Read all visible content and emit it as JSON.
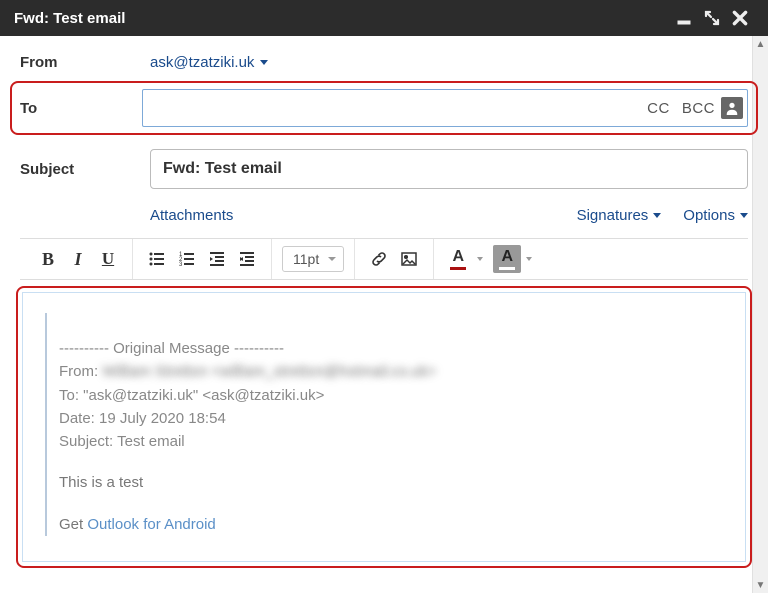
{
  "window": {
    "title": "Fwd: Test email"
  },
  "from": {
    "label": "From",
    "value": "ask@tzatziki.uk"
  },
  "to": {
    "label": "To",
    "value": "",
    "cc_label": "CC",
    "bcc_label": "BCC"
  },
  "subject": {
    "label": "Subject",
    "value": "Fwd: Test email"
  },
  "actions": {
    "attachments": "Attachments",
    "signatures": "Signatures",
    "options": "Options"
  },
  "toolbar": {
    "fontsize": "11pt"
  },
  "body": {
    "separator": "---------- Original Message ----------",
    "from_prefix": "From: ",
    "from_redacted": "William Stretton <william_stretton@hotmail.co.uk>",
    "to_line": "To: \"ask@tzatziki.uk\" <ask@tzatziki.uk>",
    "date_line": "Date: 19 July 2020 18:54",
    "subject_line": "Subject: Test email",
    "message": "This is a test",
    "signature_prefix": "Get ",
    "signature_link": "Outlook for Android"
  }
}
